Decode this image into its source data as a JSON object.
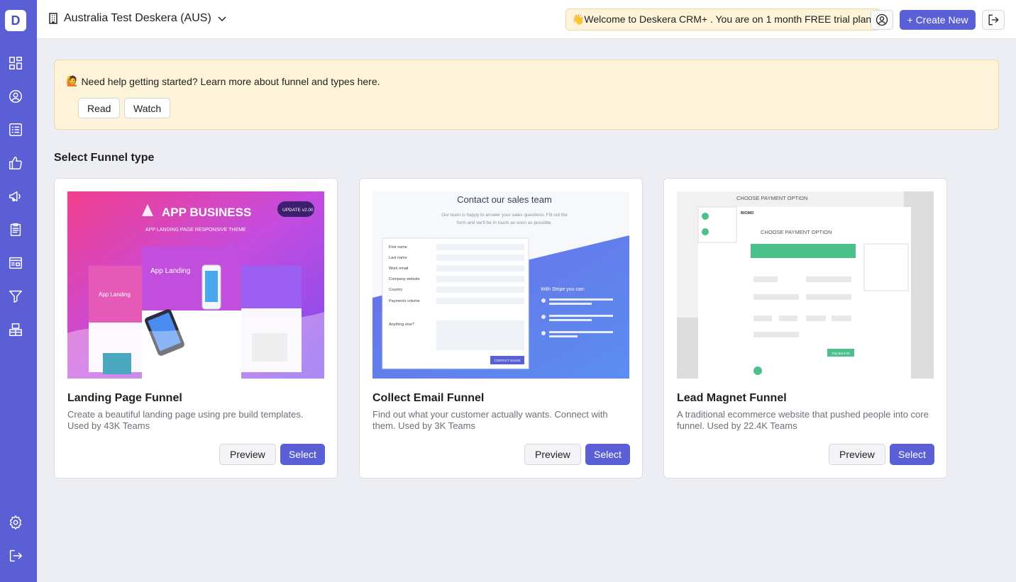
{
  "app": {
    "logo_letter": "D"
  },
  "header": {
    "org_name": "Australia Test Deskera (AUS)",
    "trial_text": "👋Welcome to Deskera CRM+ . You are on 1 month FREE trial plan.",
    "create_label": "+ Create New"
  },
  "help": {
    "text": "Need help getting started? Learn more about funnel and types here.",
    "emoji": "🙋",
    "read_label": "Read",
    "watch_label": "Watch"
  },
  "section": {
    "title": "Select Funnel type"
  },
  "cards": [
    {
      "title": "Landing Page Funnel",
      "description": "Create a beautiful landing page using pre build templates. Used by 43K Teams",
      "preview_label": "Preview",
      "select_label": "Select",
      "thumb": {
        "brand": "APP BUSINESS",
        "subtitle": "APP LANDING PAGE RESPONSIVE THEME",
        "badge": "UPDATE v2.00",
        "phone_text": "App Landing",
        "side_text": "App Landing"
      }
    },
    {
      "title": "Collect Email Funnel",
      "description": "Find out what your customer actually wants. Connect with them. Used by 3K Teams",
      "preview_label": "Preview",
      "select_label": "Select",
      "thumb": {
        "heading": "Contact our sales team",
        "sub": "Our team is happy to answer your sales questions. Fill out the form and we'll be in touch as soon as possible.",
        "fields": [
          "First name",
          "Last name",
          "Work email",
          "Company website",
          "Country",
          "Payments volume",
          "Anything else?"
        ],
        "cta": "CONTACT SALES",
        "stripe_heading": "With Stripe you can:"
      }
    },
    {
      "title": "Lead Magnet Funnel",
      "description": "A traditional ecommerce website that pushed people into core funnel. Used by 22.4K Teams",
      "preview_label": "Preview",
      "select_label": "Select",
      "thumb": {
        "top_label": "CHOOSE PAYMENT OPTION",
        "inner_label": "CHOOSE PAYMENT OPTION",
        "brand": "BIOMD",
        "pay_label": "Pay $114.00"
      }
    }
  ],
  "colors": {
    "sidebar": "#5b5fd6",
    "accent": "#5b5fd6",
    "banner": "#fdf3d8",
    "background": "#eceef3"
  }
}
